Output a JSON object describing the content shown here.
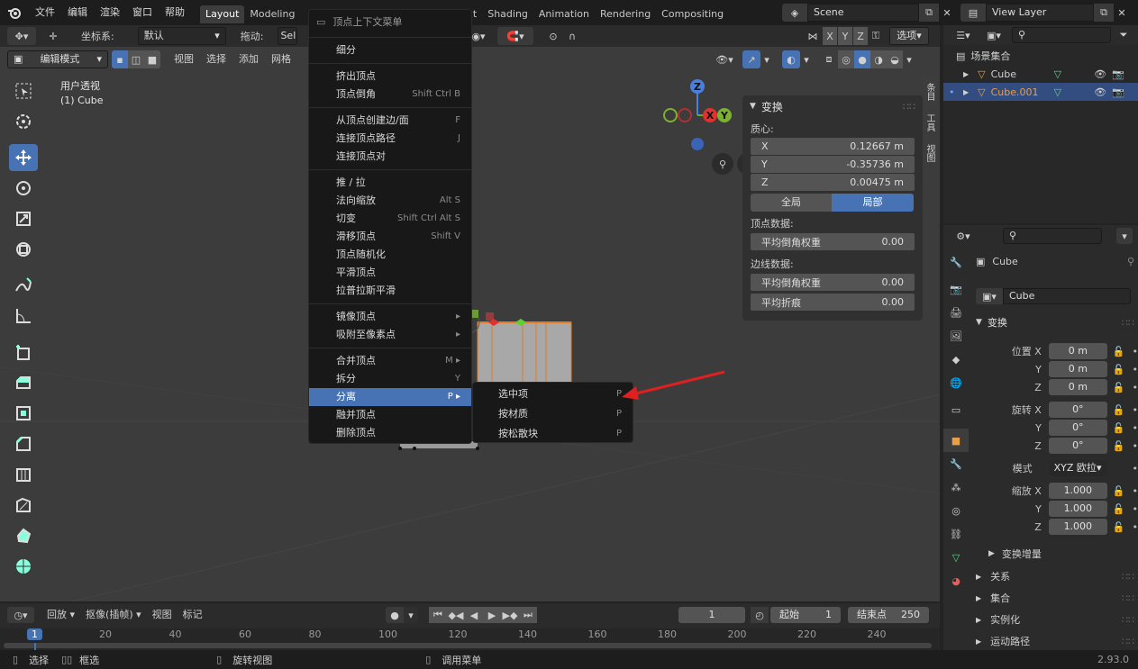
{
  "app_menu": [
    "文件",
    "编辑",
    "渲染",
    "窗口",
    "帮助"
  ],
  "workspace_tabs": [
    "Layout",
    "Modeling",
    "re Paint",
    "Shading",
    "Animation",
    "Rendering",
    "Compositing"
  ],
  "active_tab": "Layout",
  "scene_name": "Scene",
  "view_layer": "View Layer",
  "toolbar": {
    "coord_label": "坐标系:",
    "coord_value": "默认",
    "drag_label": "拖动:",
    "drag_value": "Sel",
    "options": "选项",
    "axes": [
      "X",
      "Y",
      "Z"
    ]
  },
  "viewport_header": {
    "mode": "编辑模式",
    "menus": [
      "视图",
      "选择",
      "添加",
      "网格"
    ]
  },
  "viewport": {
    "title": "用户透视",
    "subtitle": "(1) Cube"
  },
  "gizmo": {
    "z": "Z",
    "y": "Y",
    "x": "X"
  },
  "context_menu": {
    "title": "顶点上下文菜单",
    "groups": [
      [
        {
          "label": "细分",
          "shortcut": ""
        }
      ],
      [
        {
          "label": "挤出顶点",
          "shortcut": ""
        },
        {
          "label": "顶点倒角",
          "shortcut": "Shift Ctrl B"
        }
      ],
      [
        {
          "label": "从顶点创建边/面",
          "shortcut": "F"
        },
        {
          "label": "连接顶点路径",
          "shortcut": "J"
        },
        {
          "label": "连接顶点对",
          "shortcut": ""
        }
      ],
      [
        {
          "label": "推 / 拉",
          "shortcut": ""
        },
        {
          "label": "法向缩放",
          "shortcut": "Alt S"
        },
        {
          "label": "切变",
          "shortcut": "Shift Ctrl Alt S"
        },
        {
          "label": "滑移顶点",
          "shortcut": "Shift V"
        },
        {
          "label": "顶点随机化",
          "shortcut": ""
        },
        {
          "label": "平滑顶点",
          "shortcut": ""
        },
        {
          "label": "拉普拉斯平滑",
          "shortcut": ""
        }
      ],
      [
        {
          "label": "镜像顶点",
          "shortcut": "▸"
        },
        {
          "label": "吸附至像素点",
          "shortcut": "▸"
        }
      ],
      [
        {
          "label": "合并顶点",
          "shortcut": "M ▸"
        },
        {
          "label": "拆分",
          "shortcut": "Y"
        },
        {
          "label": "分离",
          "shortcut": "P ▸"
        },
        {
          "label": "融并顶点",
          "shortcut": ""
        },
        {
          "label": "删除顶点",
          "shortcut": ""
        }
      ]
    ],
    "highlighted": "分离"
  },
  "submenu": [
    {
      "label": "选中项",
      "shortcut": "P"
    },
    {
      "label": "按材质",
      "shortcut": "P"
    },
    {
      "label": "按松散块",
      "shortcut": "P"
    }
  ],
  "npanel": {
    "title": "变换",
    "median_label": "质心:",
    "x_label": "X",
    "x_value": "0.12667 m",
    "y_label": "Y",
    "y_value": "-0.35736 m",
    "z_label": "Z",
    "z_value": "0.00475 m",
    "global": "全局",
    "local": "局部",
    "vertex_data": "顶点数据:",
    "bevel_weight": "平均倒角权重",
    "bevel_weight_value": "0.00",
    "edge_data": "边线数据:",
    "edge_bevel_weight": "平均倒角权重",
    "edge_bevel_value": "0.00",
    "crease": "平均折痕",
    "crease_value": "0.00",
    "side_tabs": [
      "条目",
      "工具",
      "视图"
    ]
  },
  "outliner": {
    "collection": "场景集合",
    "items": [
      {
        "name": "Cube",
        "color": "#d0d0d0"
      },
      {
        "name": "Cube.001",
        "color": "#e8a048"
      }
    ]
  },
  "properties": {
    "object_name": "Cube",
    "data_name": "Cube",
    "transform_title": "变换",
    "loc_label": "位置 X",
    "loc": [
      "0 m",
      "0 m",
      "0 m"
    ],
    "rot_label": "旋转 X",
    "rot": [
      "0°",
      "0°",
      "0°"
    ],
    "mode_label": "模式",
    "mode_value": "XYZ 欧拉",
    "scale_label": "缩放 X",
    "scale": [
      "1.000",
      "1.000",
      "1.000"
    ],
    "y": "Y",
    "z": "Z",
    "delta": "变换增量",
    "sections": [
      "关系",
      "集合",
      "实例化",
      "运动路径"
    ]
  },
  "timeline": {
    "menus": [
      "回放",
      "抠像(插帧)",
      "视图",
      "标记"
    ],
    "current_frame": "1",
    "start_label": "起始",
    "start_value": "1",
    "end_label": "结束点",
    "end_value": "250",
    "ticks": [
      "1",
      "20",
      "40",
      "60",
      "80",
      "100",
      "120",
      "140",
      "160",
      "180",
      "200",
      "220",
      "240"
    ]
  },
  "status_bar": {
    "select": "选择",
    "box_select": "框选",
    "rotate_view": "旋转视图",
    "call_menu": "调用菜单",
    "version": "2.93.0"
  },
  "colors": {
    "accent": "#4772b3",
    "arrow": "#e02020",
    "orange": "#e8a048"
  }
}
